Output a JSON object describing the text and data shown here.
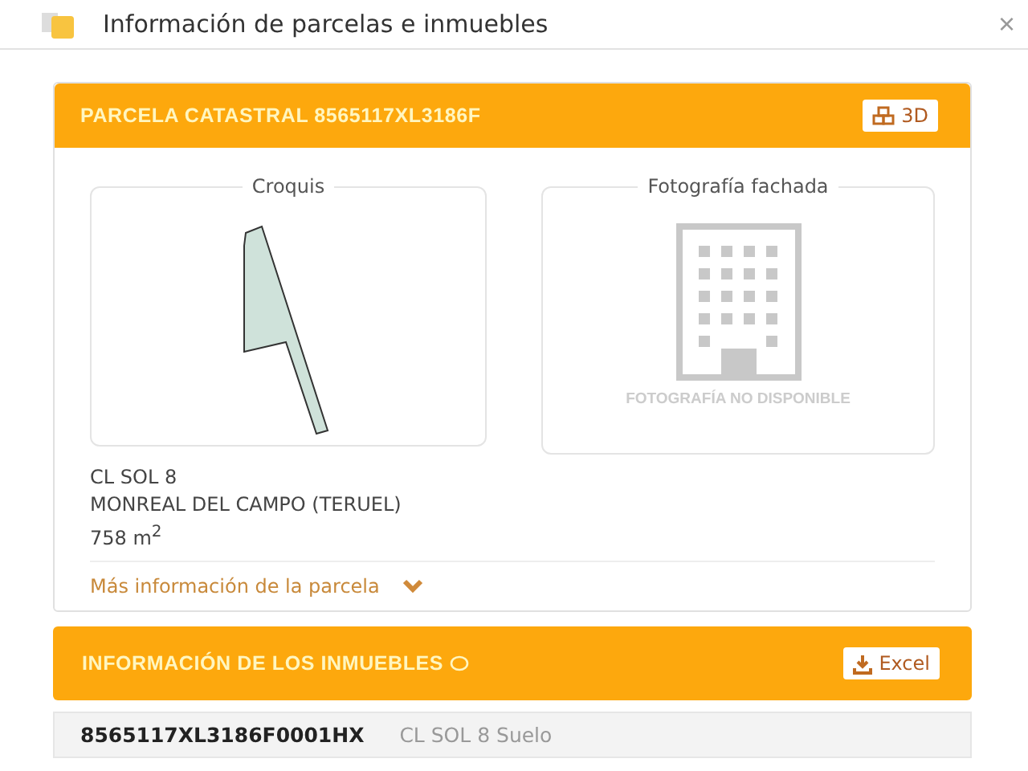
{
  "window": {
    "title": "Información de parcelas e inmuebles",
    "close": "×"
  },
  "parcel": {
    "title": "PARCELA CATASTRAL 8565117XL3186F",
    "button_3d": "3D",
    "sketch_label": "Croquis",
    "photo_label": "Fotografía fachada",
    "photo_missing": "FOTOGRAFÍA NO DISPONIBLE",
    "address_lines": [
      "CL SOL 8",
      "MONREAL DEL CAMPO (TERUEL)"
    ],
    "area": "758 m$^{2}$",
    "more_link": "Más información de la parcela",
    "expanded": false
  },
  "properties": {
    "title": "INFORMACIÓN DE LOS INMUEBLES",
    "excel_button": "Excel",
    "rows": [
      {
        "reference": "8565117XL3186F0001HX",
        "description": "CL SOL 8 Suelo"
      }
    ]
  }
}
